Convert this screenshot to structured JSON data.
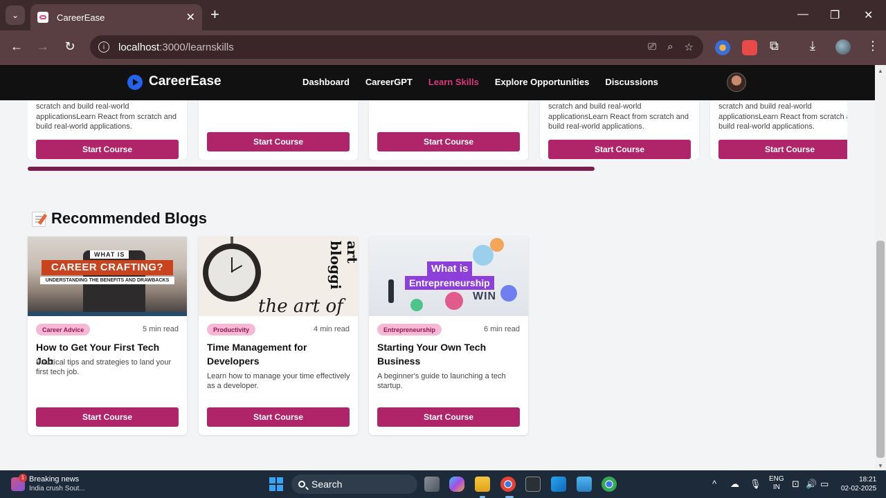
{
  "browser": {
    "tab_title": "CareerEase",
    "url_host": "localhost",
    "url_path": ":3000/learnskills",
    "tab_close": "✕",
    "new_tab": "+"
  },
  "site": {
    "logo_text": "CareerEase",
    "nav": [
      "Dashboard",
      "CareerGPT",
      "Learn Skills",
      "Explore Opportunities",
      "Discussions"
    ],
    "active_nav": "Learn Skills",
    "accent_color": "#b0256a"
  },
  "courses": [
    {
      "description": "scratch and build real-world applicationsLearn React from scratch and build real-world applications.",
      "button": "Start Course"
    },
    {
      "description": "",
      "button": "Start Course"
    },
    {
      "description": "",
      "button": "Start Course"
    },
    {
      "description": "scratch and build real-world applicationsLearn React from scratch and build real-world applications.",
      "button": "Start Course"
    },
    {
      "description": "scratch and build real-world applicationsLearn React from scratch and build real-world applications.",
      "button": "Start Course"
    }
  ],
  "blogs_section": {
    "title": "Recommended Blogs",
    "icon": "memo-icon"
  },
  "blogs": [
    {
      "category": "Career Advice",
      "read_time": "5 min read",
      "title": "How to Get Your First Tech Job",
      "description": "Practical tips and strategies to land your first tech job.",
      "button": "Start Course",
      "image": {
        "line1": "WHAT IS",
        "line2": "CAREER CRAFTING?",
        "line3": "UNDERSTANDING THE BENEFITS AND DRAWBACKS"
      }
    },
    {
      "category": "Productivity",
      "read_time": "4 min read",
      "title": "Time Management for Developers",
      "description": "Learn how to manage your time effectively as a developer.",
      "button": "Start Course",
      "image": {
        "script_text": "the art of",
        "vertical_text": "art bloggi"
      }
    },
    {
      "category": "Entrepreneurship",
      "read_time": "6 min read",
      "title": "Starting Your Own Tech Business",
      "description": "A beginner's guide to launching a tech startup.",
      "button": "Start Course",
      "image": {
        "line1": "What is",
        "line2": "Entrepreneurship",
        "line3": "WIN"
      }
    }
  ],
  "taskbar": {
    "news_title": "Breaking news",
    "news_subtitle": "India crush Sout...",
    "news_badge": "1",
    "search_label": "Search",
    "language_1": "ENG",
    "language_2": "IN",
    "time": "18:21",
    "date": "02-02-2025"
  }
}
